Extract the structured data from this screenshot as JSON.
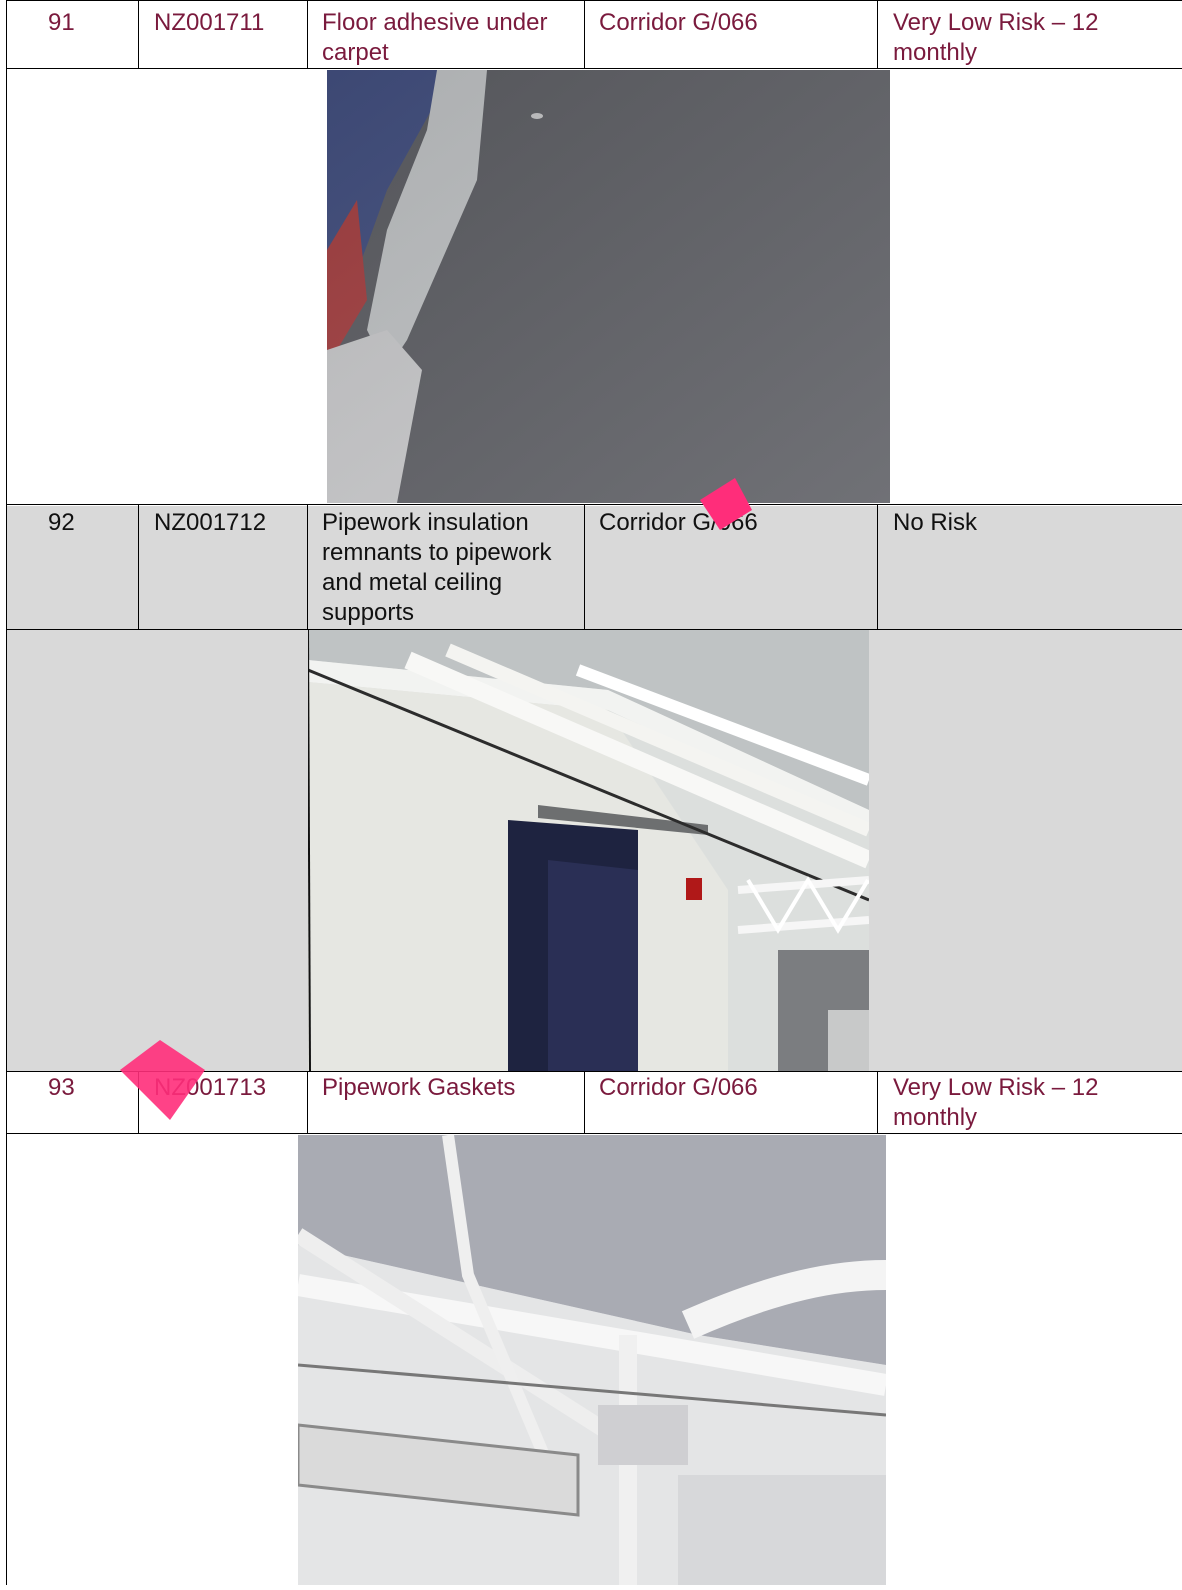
{
  "colors": {
    "text_risk_rows": "#7a1a3d",
    "text_norisk_row": "#111111",
    "row_shade": "#d9d9d9",
    "watermark": "#ff2d7a"
  },
  "rows": [
    {
      "number": "91",
      "ref": "NZ001711",
      "description": "Floor adhesive under carpet",
      "location": "Corridor G/066",
      "risk": "Very Low Risk – 12 monthly",
      "photo_icon": "carpet-floor-photo"
    },
    {
      "number": "92",
      "ref": "NZ001712",
      "description": "Pipework insulation remnants to pipework and metal ceiling supports",
      "location": "Corridor G/066",
      "risk": "No Risk",
      "photo_icon": "ceiling-pipework-photo"
    },
    {
      "number": "93",
      "ref": "NZ001713",
      "description": "Pipework Gaskets",
      "location": "Corridor G/066",
      "risk": "Very Low Risk – 12 monthly",
      "photo_icon": "ceiling-gaskets-photo"
    }
  ]
}
